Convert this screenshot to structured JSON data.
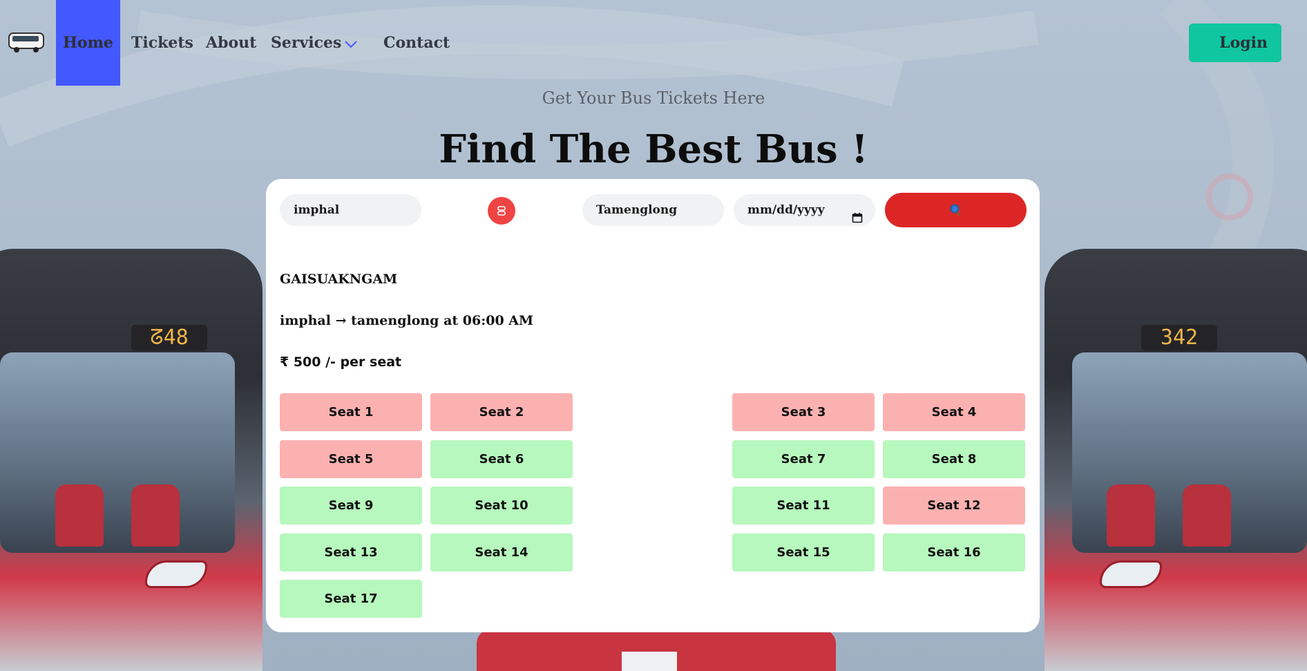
{
  "nav": {
    "links": [
      {
        "label": "Home"
      },
      {
        "label": "Tickets"
      },
      {
        "label": "About"
      },
      {
        "label": "Services"
      },
      {
        "label": "Contact"
      }
    ],
    "login_label": "Login",
    "accent_color": "#4458ff",
    "login_color": "#0fc6a0"
  },
  "hero": {
    "subtitle": "Get Your Bus Tickets Here",
    "title": "Find The Best Bus !"
  },
  "search": {
    "from_value": "imphal",
    "to_value": "Tamenglong",
    "date_placeholder": "mm/dd/yyyy",
    "swap_icon": "swap-icon",
    "search_icon": "magnifier-icon",
    "search_color": "#dc2626"
  },
  "result": {
    "bus_name": "GAISUAKNGAM",
    "route": "imphal → tamenglong at 06:00 AM",
    "price": "₹ 500 /- per seat"
  },
  "seats": [
    {
      "label": "Seat 1",
      "status": "booked"
    },
    {
      "label": "Seat 2",
      "status": "booked"
    },
    {
      "label": "Seat 3",
      "status": "booked"
    },
    {
      "label": "Seat 4",
      "status": "booked"
    },
    {
      "label": "Seat 5",
      "status": "booked"
    },
    {
      "label": "Seat 6",
      "status": "available"
    },
    {
      "label": "Seat 7",
      "status": "available"
    },
    {
      "label": "Seat 8",
      "status": "available"
    },
    {
      "label": "Seat 9",
      "status": "available"
    },
    {
      "label": "Seat 10",
      "status": "available"
    },
    {
      "label": "Seat 11",
      "status": "available"
    },
    {
      "label": "Seat 12",
      "status": "booked"
    },
    {
      "label": "Seat 13",
      "status": "available"
    },
    {
      "label": "Seat 14",
      "status": "available"
    },
    {
      "label": "Seat 15",
      "status": "available"
    },
    {
      "label": "Seat 16",
      "status": "available"
    },
    {
      "label": "Seat 17",
      "status": "available"
    }
  ],
  "colors": {
    "booked": "#fcb1b1",
    "available": "#b6f8bd"
  }
}
